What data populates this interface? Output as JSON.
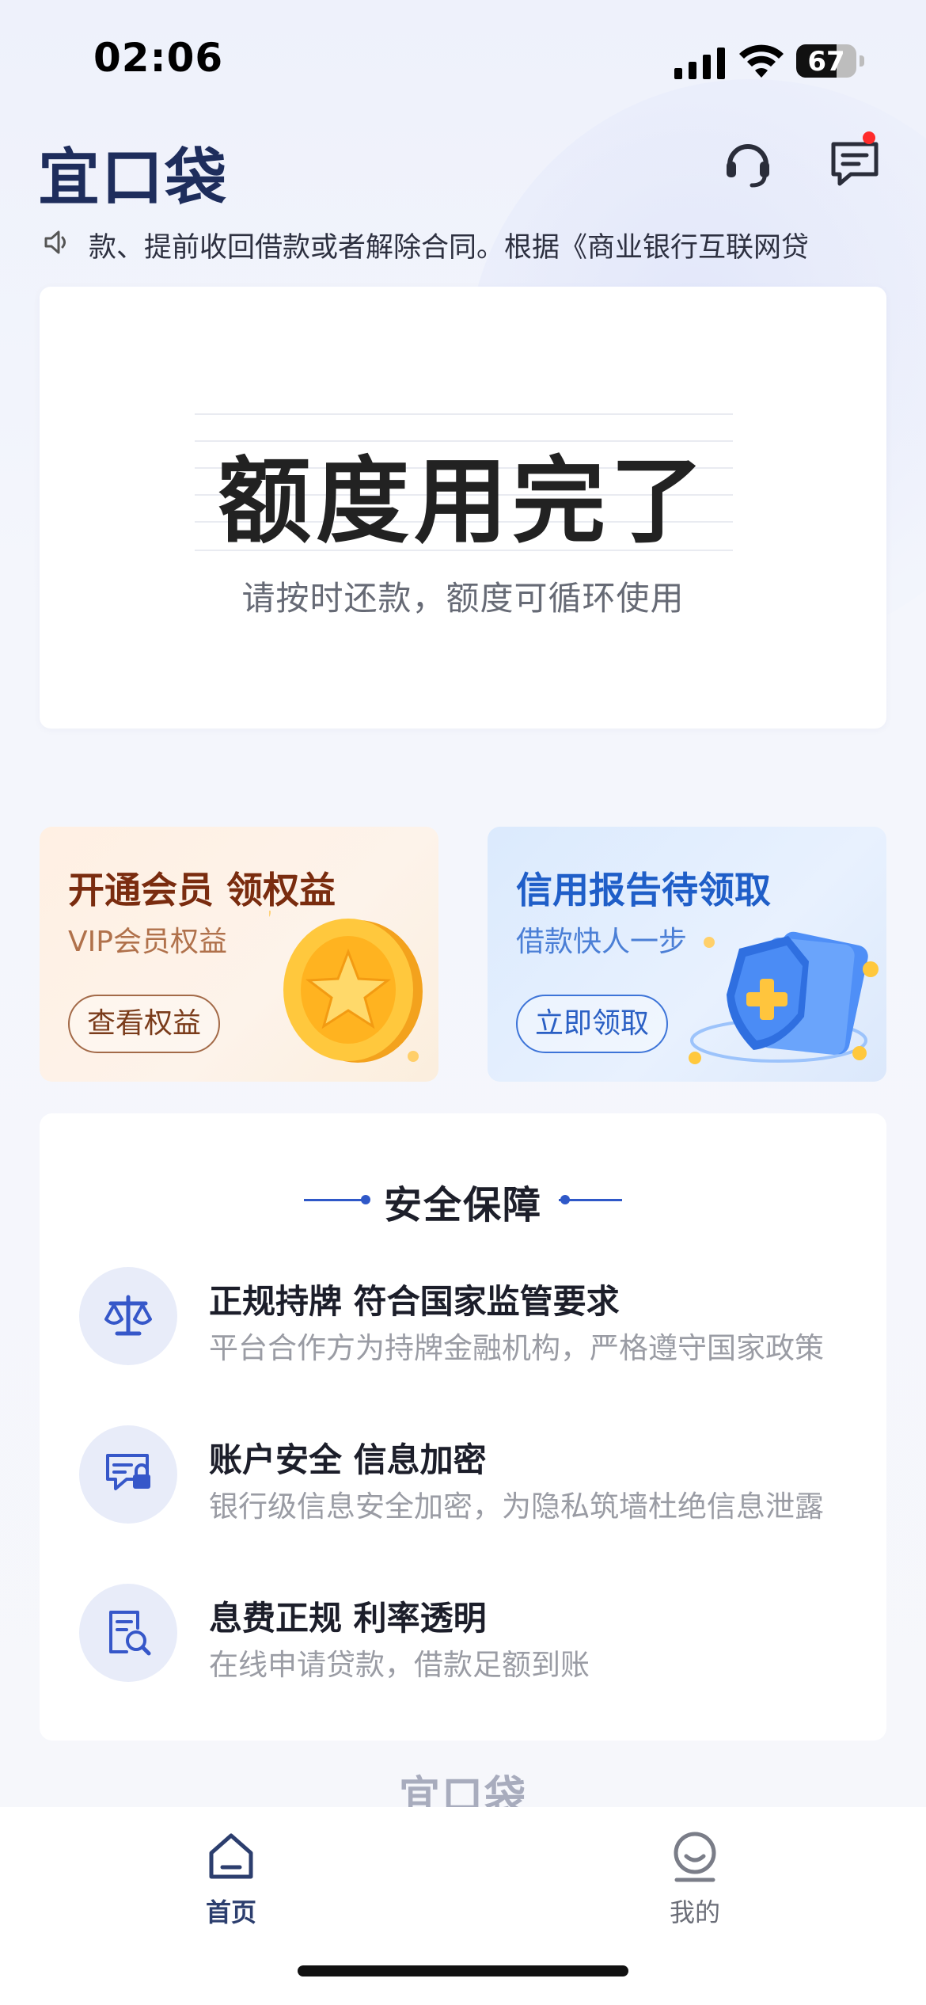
{
  "status_bar": {
    "time": "02:06",
    "battery": "67",
    "battery_level": 0.67
  },
  "header": {
    "logo": "宜口袋",
    "support_icon": "headset-icon",
    "message_icon": "message-icon",
    "has_unread": true
  },
  "notice": {
    "icon": "speaker-icon",
    "text": "款、提前收回借款或者解除合同。根据《商业银行互联网贷"
  },
  "quota": {
    "title": "额度用完了",
    "subtitle": "请按时还款，额度可循环使用"
  },
  "promos": [
    {
      "title": "开通会员 领权益",
      "subtitle": "VIP会员权益",
      "button": "查看权益",
      "icon": "coin-star-icon"
    },
    {
      "title": "信用报告待领取",
      "subtitle": "借款快人一步",
      "button": "立即领取",
      "icon": "shield-plus-icon"
    }
  ],
  "security": {
    "title": "安全保障",
    "items": [
      {
        "title": "正规持牌 符合国家监管要求",
        "desc": "平台合作方为持牌金融机构，严格遵守国家政策",
        "icon": "scale-icon"
      },
      {
        "title": "账户安全 信息加密",
        "desc": "银行级信息安全加密，为隐私筑墙杜绝信息泄露",
        "icon": "lock-card-icon"
      },
      {
        "title": "息费正规  利率透明",
        "desc": "在线申请贷款，借款足额到账",
        "icon": "document-search-icon"
      }
    ]
  },
  "footer_logo": "宜口袋",
  "tabs": [
    {
      "label": "首页",
      "icon": "home-icon",
      "active": true
    },
    {
      "label": "我的",
      "icon": "profile-icon",
      "active": false
    }
  ],
  "colors": {
    "accent": "#2f58c8",
    "brand": "#1e2d5c",
    "vip": "#7a2c0f",
    "credit": "#1f5ec8"
  }
}
